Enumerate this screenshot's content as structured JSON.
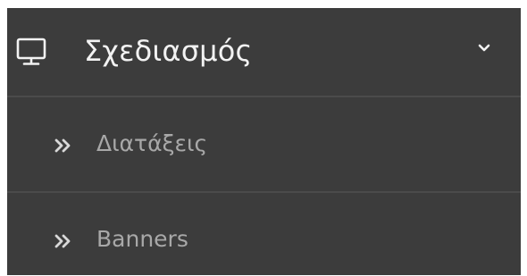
{
  "menu": {
    "header": {
      "icon": "monitor-icon",
      "title": "Σχεδιασμός",
      "expand_icon": "chevron-down-icon"
    },
    "items": [
      {
        "icon": "double-chevron-right-icon",
        "label": "Διατάξεις"
      },
      {
        "icon": "double-chevron-right-icon",
        "label": "Banners"
      }
    ]
  },
  "colors": {
    "background": "#3c3c3c",
    "divider": "#4b4b4b",
    "title_text": "#f2f2f2",
    "item_text": "#a8a8a8"
  }
}
